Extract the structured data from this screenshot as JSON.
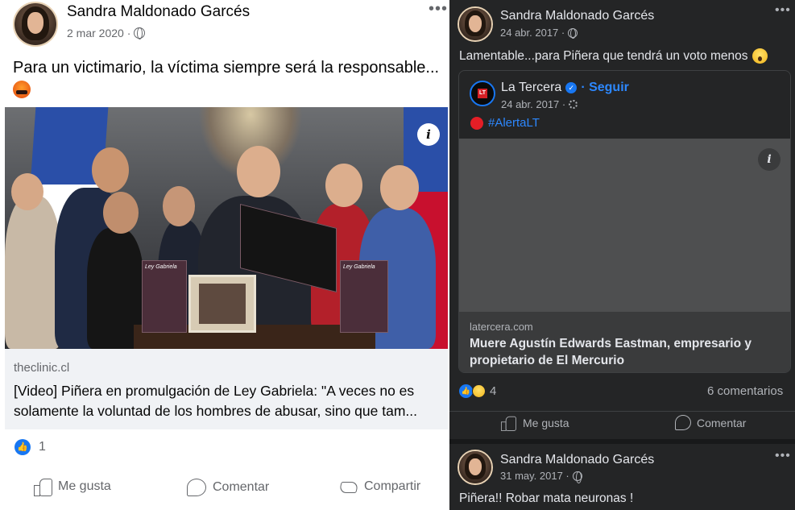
{
  "left_post": {
    "author": "Sandra Maldonado Garcés",
    "date": "2 mar 2020 ·",
    "text": "Para un victimario, la víctima siempre será la responsable...",
    "menu_icon": "more-dots-icon",
    "link": {
      "domain": "theclinic.cl",
      "title": "[Video] Piñera en promulgación de Ley Gabriela: \"A veces no es solamente la voluntad de los hombres de abusar, sino que tam...",
      "photo_book_label": "Ley Gabriela",
      "info_symbol": "i"
    },
    "reaction_count": "1",
    "actions": {
      "like": "Me gusta",
      "comment": "Comentar",
      "share": "Compartir"
    }
  },
  "right_post1": {
    "author": "Sandra Maldonado Garcés",
    "date": "24 abr. 2017 ·",
    "text": "Lamentable...para Piñera que tendrá un voto menos",
    "shared": {
      "page_name": "La Tercera",
      "follow": "· Seguir",
      "date": "24 abr. 2017 ·",
      "logo_text": "LT",
      "hashtag": "#AlertaLT",
      "info_symbol": "i",
      "domain": "latercera.com",
      "title": "Muere Agustín Edwards Eastman, empresario y propietario de El Mercurio"
    },
    "reaction_count": "4",
    "comments": "6 comentarios",
    "actions": {
      "like": "Me gusta",
      "comment": "Comentar"
    }
  },
  "right_post2": {
    "author": "Sandra Maldonado Garcés",
    "date": "31 may. 2017 ·",
    "text": "Piñera!! Robar mata neuronas !"
  },
  "colors": {
    "facebook_blue": "#1877f2",
    "dark_bg": "#242526",
    "dark_text": "#e4e6eb",
    "light_secondary": "#65676b"
  }
}
